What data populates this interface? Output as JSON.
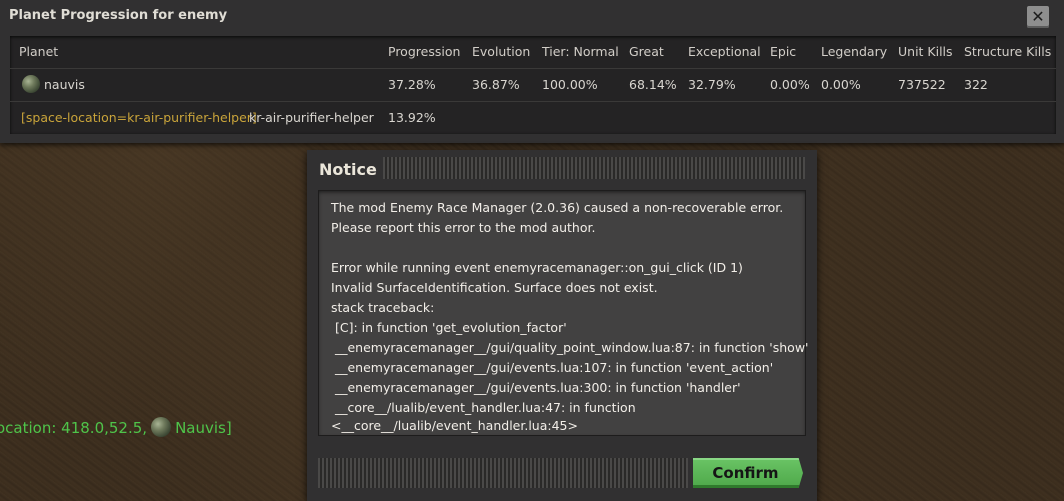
{
  "window": {
    "title": "Planet Progression for enemy",
    "close_icon": "close-icon"
  },
  "table": {
    "headers": [
      "Planet",
      "Progression",
      "Evolution",
      "Tier: Normal",
      "Great",
      "Exceptional",
      "Epic",
      "Legendary",
      "Unit Kills",
      "Structure Kills"
    ],
    "rows": [
      {
        "planet_icon": "planet-nauvis-icon",
        "planet": "nauvis",
        "progression": "37.28%",
        "evolution": "36.87%",
        "tier_normal": "100.00%",
        "great": "68.14%",
        "exceptional": "32.79%",
        "epic": "0.00%",
        "legendary": "0.00%",
        "unit_kills": "737522",
        "structure_kills": "322"
      },
      {
        "planet_tag": "[space-location=kr-air-purifier-helper]",
        "planet": "kr-air-purifier-helper",
        "progression": "13.92%"
      }
    ]
  },
  "location": {
    "text": "ocation: 418.0,52.5,",
    "planet": "Nauvis]"
  },
  "notice": {
    "title": "Notice",
    "lines": [
      "The mod Enemy Race Manager (2.0.36) caused a non-recoverable error.",
      "Please report this error to the mod author.",
      "",
      "Error while running event enemyracemanager::on_gui_click (ID 1)",
      "Invalid SurfaceIdentification. Surface does not exist.",
      "stack traceback:",
      " [C]: in function 'get_evolution_factor'",
      " __enemyracemanager__/gui/quality_point_window.lua:87: in function 'show'",
      " __enemyracemanager__/gui/events.lua:107: in function 'event_action'",
      " __enemyracemanager__/gui/events.lua:300: in function 'handler'",
      " __core__/lualib/event_handler.lua:47: in function",
      "<__core__/lualib/event_handler.lua:45>"
    ],
    "confirm_label": "Confirm"
  }
}
